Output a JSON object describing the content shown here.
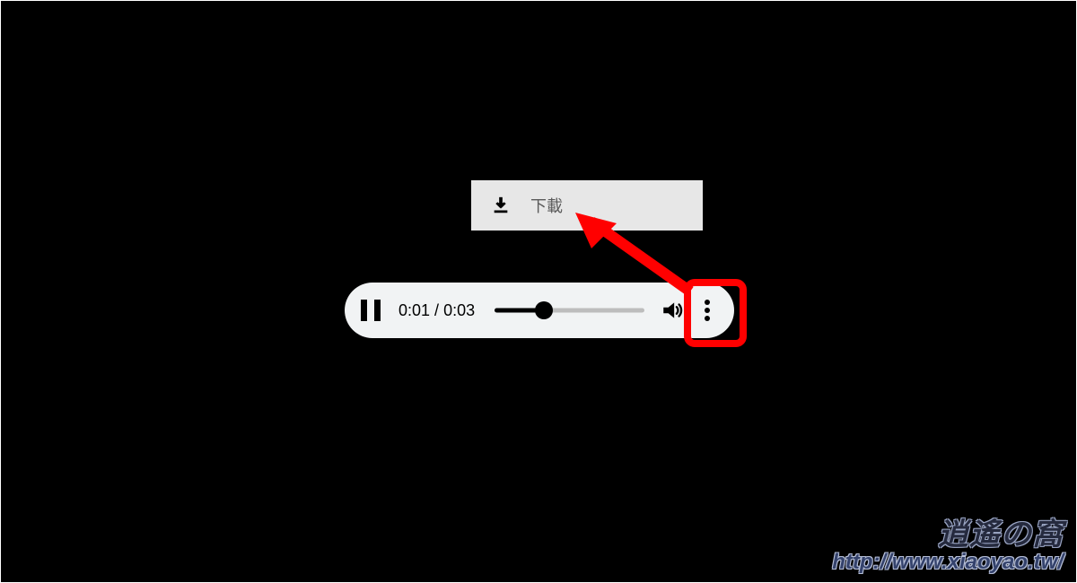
{
  "popover": {
    "download_label": "下載"
  },
  "player": {
    "current_time": "0:01",
    "duration": "0:03",
    "separator": " / ",
    "progress_percent": 33
  },
  "highlight": {
    "color": "#ff0000"
  },
  "watermark": {
    "title": "逍遙の窩",
    "url": "http://www.xiaoyao.tw/"
  }
}
